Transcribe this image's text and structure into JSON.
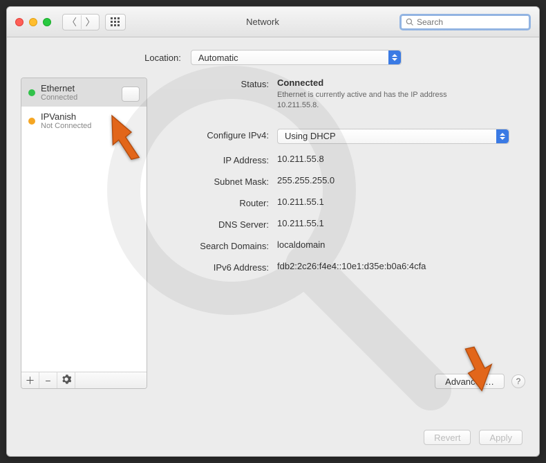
{
  "window": {
    "title": "Network"
  },
  "search": {
    "placeholder": "Search"
  },
  "location": {
    "label": "Location:",
    "value": "Automatic"
  },
  "sidebar": {
    "items": [
      {
        "name": "Ethernet",
        "status": "Connected",
        "dot": "green"
      },
      {
        "name": "IPVanish",
        "status": "Not Connected",
        "dot": "yellow"
      }
    ]
  },
  "detail": {
    "status_label": "Status:",
    "status_value": "Connected",
    "status_sub": "Ethernet is currently active and has the IP address 10.211.55.8.",
    "configure_label": "Configure IPv4:",
    "configure_value": "Using DHCP",
    "rows": [
      {
        "label": "IP Address:",
        "value": "10.211.55.8"
      },
      {
        "label": "Subnet Mask:",
        "value": "255.255.255.0"
      },
      {
        "label": "Router:",
        "value": "10.211.55.1"
      },
      {
        "label": "DNS Server:",
        "value": "10.211.55.1",
        "grey": true
      },
      {
        "label": "Search Domains:",
        "value": "localdomain",
        "grey": true
      },
      {
        "label": "IPv6 Address:",
        "value": "fdb2:2c26:f4e4::10e1:d35e:b0a6:4cfa"
      }
    ],
    "advanced_label": "Advanced…"
  },
  "footer": {
    "revert": "Revert",
    "apply": "Apply"
  }
}
